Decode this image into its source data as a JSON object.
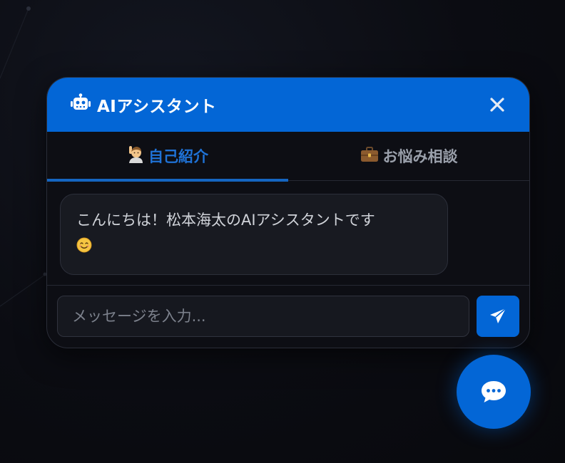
{
  "header": {
    "icon": "robot-icon",
    "title": "AIアシスタント",
    "close_icon": "close-icon"
  },
  "tabs": [
    {
      "label": "自己紹介",
      "icon": "person-raising-hand-icon",
      "active": true
    },
    {
      "label": "お悩み相談",
      "icon": "briefcase-icon",
      "active": false
    }
  ],
  "messages": [
    {
      "sender": "assistant",
      "text": "こんにちは！松本海太のAIアシスタントです",
      "emoji": "smiling-face-icon"
    }
  ],
  "input": {
    "placeholder": "メッセージを入力...",
    "value": ""
  },
  "send_button": {
    "icon": "paper-plane-icon"
  },
  "fab": {
    "icon": "chat-bubble-icon"
  },
  "colors": {
    "accent": "#0366d6",
    "active_tab": "#1f72d6",
    "background": "#0a0b10",
    "panel": "#0d0e14",
    "bubble": "#181a21"
  }
}
